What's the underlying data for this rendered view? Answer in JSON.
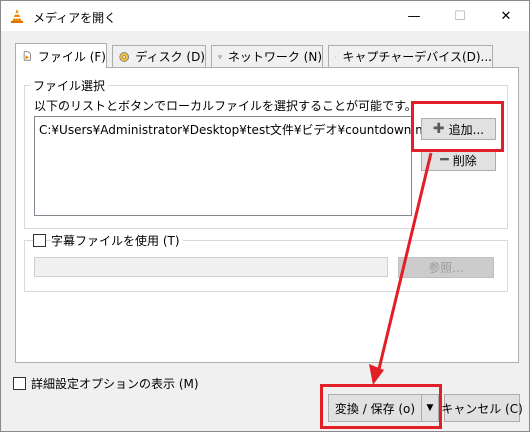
{
  "window": {
    "title": "メディアを開く",
    "icon": "vlc-cone-icon",
    "minimize_glyph": "—",
    "maximize_glyph": "☐",
    "close_glyph": "✕"
  },
  "tabs": [
    {
      "label": "ファイル (F)",
      "icon": "file-icon",
      "active": true
    },
    {
      "label": "ディスク (D)",
      "icon": "disc-icon",
      "active": false
    },
    {
      "label": "ネットワーク (N)",
      "icon": "network-icon",
      "active": false
    },
    {
      "label": "キャプチャーデバイス(D)...",
      "icon": "capture-device-icon",
      "active": false
    }
  ],
  "file_selection": {
    "group_label": "ファイル選択",
    "description": "以下のリストとボタンでローカルファイルを選択することが可能です。",
    "files": [
      "C:¥Users¥Administrator¥Desktop¥test文件¥ビデオ¥countdown.mov"
    ],
    "add_label": "追加...",
    "add_glyph": "✚",
    "remove_label": "削除",
    "remove_glyph": "━"
  },
  "subtitle": {
    "checkbox_label": "字幕ファイルを使用 (T)",
    "checked": false,
    "path_value": "",
    "browse_label": "参照..."
  },
  "advanced": {
    "checkbox_label": "詳細設定オプションの表示 (M)",
    "checked": false
  },
  "footer": {
    "convert_label": "変換 / 保存 (o)",
    "dropdown_glyph": "▼",
    "cancel_label": "キャンセル (C)"
  },
  "colors": {
    "annotation_red": "#e21f26",
    "vlc_orange": "#f28a00"
  }
}
